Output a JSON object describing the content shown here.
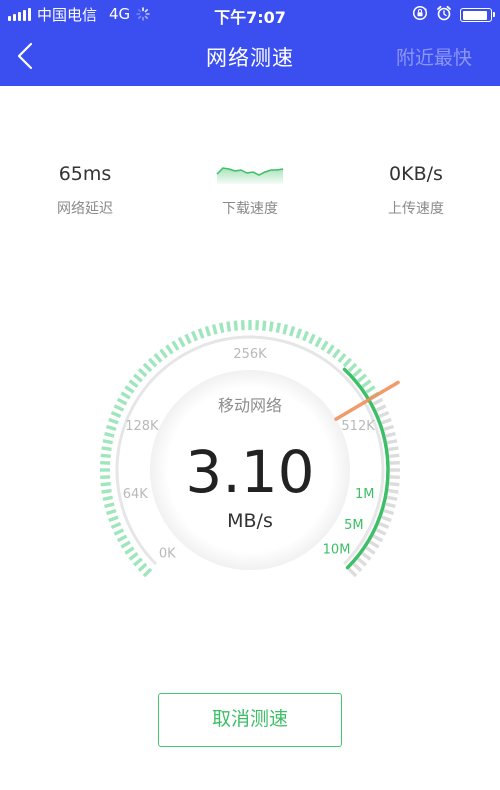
{
  "status_bar": {
    "carrier": "中国电信",
    "network": "4G",
    "time": "下午7:07"
  },
  "nav": {
    "title": "网络测速",
    "right_action": "附近最快"
  },
  "stats": {
    "latency": {
      "value": "65ms",
      "label": "网络延迟"
    },
    "download": {
      "label": "下载速度"
    },
    "upload": {
      "value": "0KB/s",
      "label": "上传速度"
    }
  },
  "gauge": {
    "network_type": "移动网络",
    "speed_value": "3.10",
    "speed_unit": "MB/s",
    "ticks": [
      "0K",
      "64K",
      "128K",
      "256K",
      "512K",
      "1M",
      "5M",
      "10M"
    ],
    "needle_level": 0.72
  },
  "cancel_label": "取消测速",
  "colors": {
    "header_bg": "#3b4ef0",
    "accent_green": "#3cbf66",
    "light_green": "#9fe6bd",
    "needle": "#f0905a"
  },
  "icons": {
    "back": "chevron-left-icon",
    "signal": "signal-bars-icon",
    "loading": "loading-spinner-icon",
    "lock_rotation": "orientation-lock-icon",
    "alarm": "alarm-clock-icon",
    "battery": "battery-icon"
  }
}
